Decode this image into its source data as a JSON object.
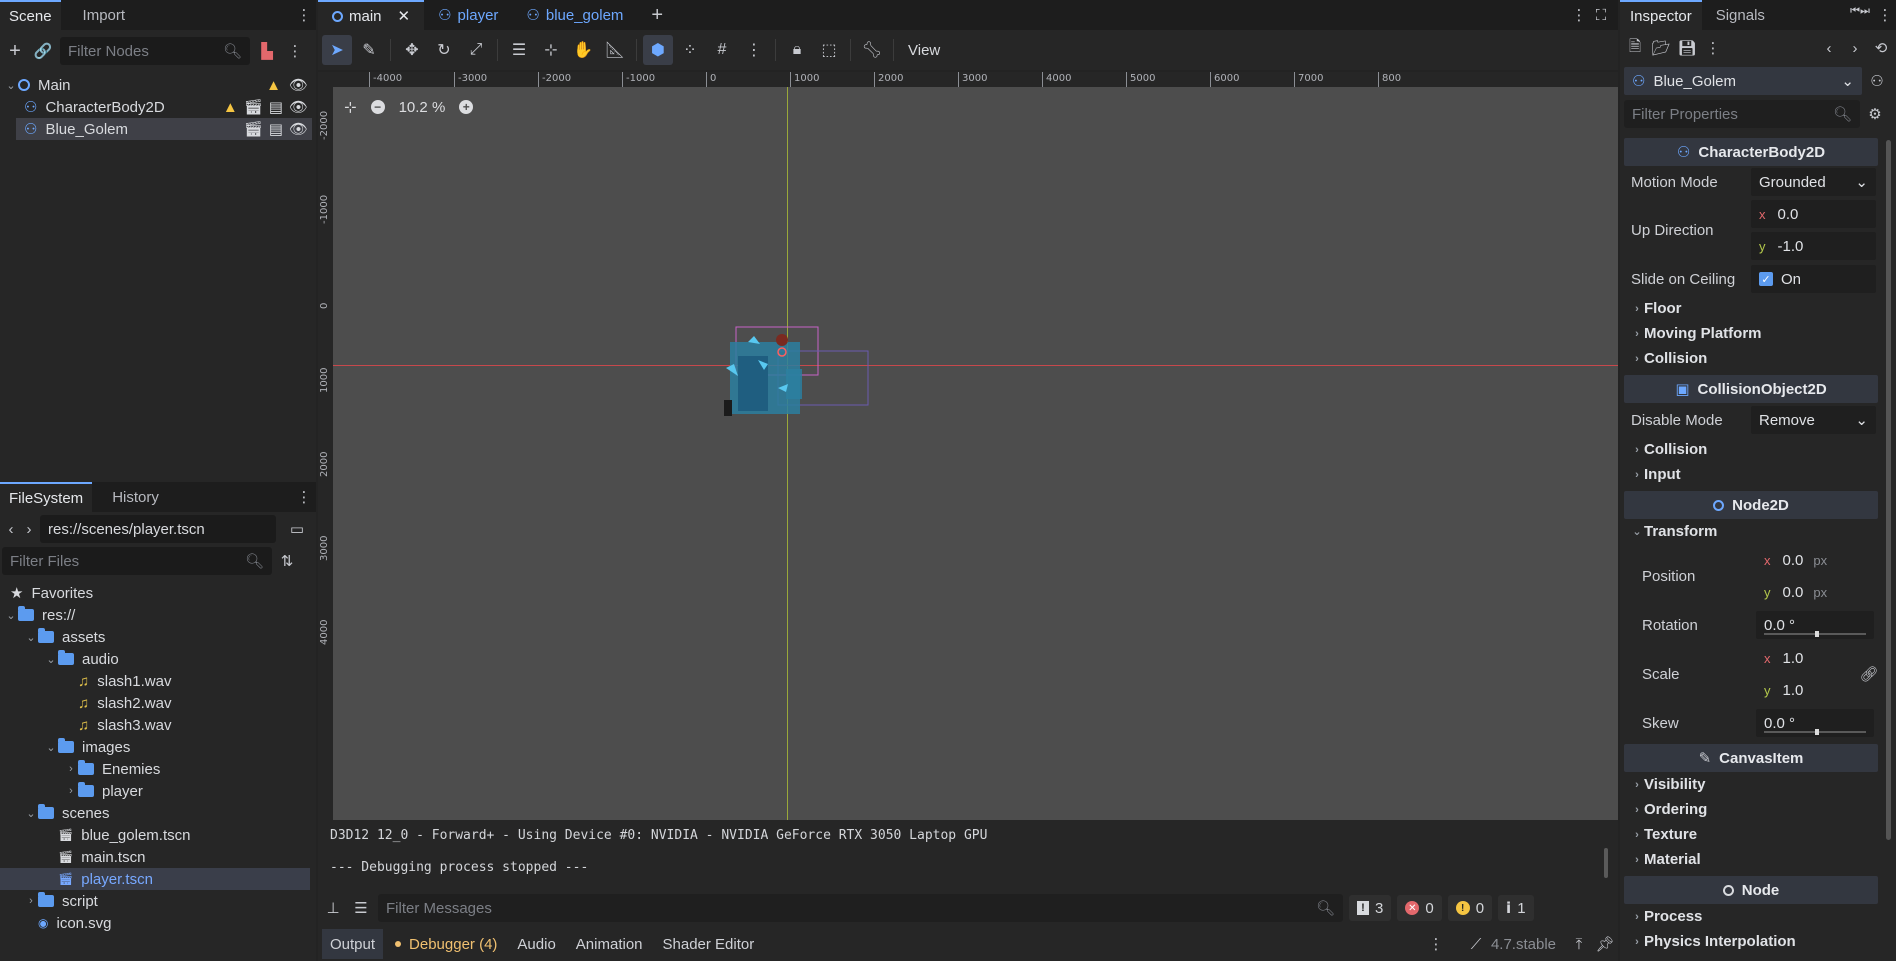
{
  "scene_dock": {
    "tabs": [
      "Scene",
      "Import"
    ],
    "filter_placeholder": "Filter Nodes",
    "nodes": [
      {
        "label": "Main",
        "warning": true
      },
      {
        "label": "CharacterBody2D",
        "warning": true
      },
      {
        "label": "Blue_Golem",
        "warning": false
      }
    ]
  },
  "filesystem": {
    "tabs": [
      "FileSystem",
      "History"
    ],
    "path": "res://scenes/player.tscn",
    "filter_placeholder": "Filter Files",
    "items": [
      {
        "label": "Favorites",
        "depth": 0,
        "kind": "star"
      },
      {
        "label": "res://",
        "depth": 0,
        "kind": "folder",
        "open": true
      },
      {
        "label": "assets",
        "depth": 1,
        "kind": "folder",
        "open": true
      },
      {
        "label": "audio",
        "depth": 2,
        "kind": "folder",
        "open": true
      },
      {
        "label": "slash1.wav",
        "depth": 3,
        "kind": "audio"
      },
      {
        "label": "slash2.wav",
        "depth": 3,
        "kind": "audio"
      },
      {
        "label": "slash3.wav",
        "depth": 3,
        "kind": "audio"
      },
      {
        "label": "images",
        "depth": 2,
        "kind": "folder",
        "open": true
      },
      {
        "label": "Enemies",
        "depth": 3,
        "kind": "folder",
        "open": false
      },
      {
        "label": "player",
        "depth": 3,
        "kind": "folder",
        "open": false
      },
      {
        "label": "scenes",
        "depth": 1,
        "kind": "folder",
        "open": true
      },
      {
        "label": "blue_golem.tscn",
        "depth": 2,
        "kind": "scene"
      },
      {
        "label": "main.tscn",
        "depth": 2,
        "kind": "scene"
      },
      {
        "label": "player.tscn",
        "depth": 2,
        "kind": "scene",
        "selected": true
      },
      {
        "label": "script",
        "depth": 1,
        "kind": "folder",
        "open": false
      },
      {
        "label": "icon.svg",
        "depth": 1,
        "kind": "image"
      }
    ]
  },
  "editor_tabs": [
    {
      "label": "main",
      "active": true,
      "icon": "node-circle-icon"
    },
    {
      "label": "player",
      "active": false,
      "icon": "character-body-icon"
    },
    {
      "label": "blue_golem",
      "active": false,
      "icon": "character-body-icon"
    }
  ],
  "toolbar": {
    "view_label": "View"
  },
  "viewport": {
    "zoom": "10.2 %",
    "ruler_top": [
      "-4000",
      "-3000",
      "-2000",
      "-1000",
      "0",
      "1000",
      "2000",
      "3000",
      "4000",
      "5000",
      "6000",
      "7000",
      "800"
    ],
    "ruler_left": [
      "-2000",
      "-1000",
      "0",
      "1000",
      "2000",
      "3000",
      "4000"
    ]
  },
  "output": {
    "line1": "D3D12 12_0 - Forward+ - Using Device #0: NVIDIA - NVIDIA GeForce RTX 3050 Laptop GPU",
    "line2": "--- Debugging process stopped ---",
    "filter_placeholder": "Filter Messages",
    "counts": {
      "messages": "3",
      "errors": "0",
      "warnings": "0",
      "info": "1"
    }
  },
  "bottom_tabs": [
    "Output",
    "Debugger (4)",
    "Audio",
    "Animation",
    "Shader Editor"
  ],
  "version": "4.7.stable",
  "inspector": {
    "tabs": [
      "Inspector",
      "Signals"
    ],
    "node_name": "Blue_Golem",
    "filter_placeholder": "Filter Properties",
    "sections": {
      "character_body": "CharacterBody2D",
      "collision_object": "CollisionObject2D",
      "node2d": "Node2D",
      "canvas_item": "CanvasItem",
      "node": "Node"
    },
    "props": {
      "motion_mode_label": "Motion Mode",
      "motion_mode_value": "Grounded",
      "up_direction_label": "Up Direction",
      "up_x": "0.0",
      "up_y": "-1.0",
      "slide_label": "Slide on Ceiling",
      "slide_value": "On",
      "floor": "Floor",
      "moving_platform": "Moving Platform",
      "collision": "Collision",
      "disable_mode_label": "Disable Mode",
      "disable_mode_value": "Remove",
      "collision2": "Collision",
      "input": "Input",
      "transform": "Transform",
      "position_label": "Position",
      "pos_x": "0.0",
      "pos_y": "0.0",
      "px": "px",
      "rotation_label": "Rotation",
      "rotation_value": "0.0 °",
      "scale_label": "Scale",
      "scale_x": "1.0",
      "scale_y": "1.0",
      "skew_label": "Skew",
      "skew_value": "0.0 °",
      "visibility": "Visibility",
      "ordering": "Ordering",
      "texture": "Texture",
      "material": "Material",
      "process": "Process",
      "physics_interp": "Physics Interpolation"
    }
  },
  "colors": {
    "accent": "#6da8ff",
    "warning": "#f5c542",
    "error": "#e3686c"
  }
}
